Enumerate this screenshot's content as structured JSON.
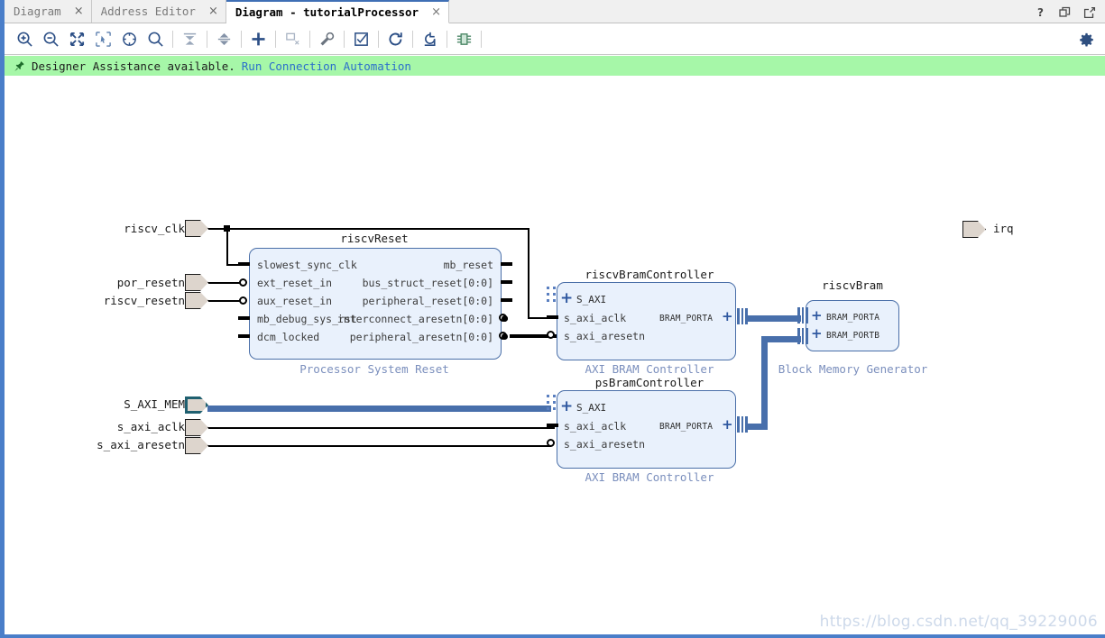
{
  "window": {
    "tabs": [
      {
        "label": "Diagram",
        "active": false,
        "close": "×"
      },
      {
        "label": "Address Editor",
        "active": false,
        "close": "×"
      },
      {
        "label": "Diagram - tutorialProcessor",
        "active": true,
        "close": "×"
      }
    ],
    "controls": [
      {
        "name": "help-icon",
        "glyph": "?"
      },
      {
        "name": "restore-icon",
        "glyph": "❐"
      },
      {
        "name": "maximize-icon",
        "glyph": "↗"
      }
    ]
  },
  "toolbar": {
    "buttons": [
      {
        "name": "zoom-in-icon",
        "tip": "Zoom In"
      },
      {
        "name": "zoom-out-icon",
        "tip": "Zoom Out"
      },
      {
        "name": "zoom-fit-icon",
        "tip": "Fit Diagram in Window"
      },
      {
        "name": "zoom-area-icon",
        "tip": "Zoom to Selected Area"
      },
      {
        "name": "refit-icon",
        "tip": "Refit"
      },
      {
        "name": "search-icon",
        "tip": "Search"
      },
      {
        "name": "collapse-all-icon",
        "tip": "Collapse All"
      },
      {
        "name": "expand-all-icon",
        "tip": "Expand All"
      },
      {
        "name": "add-ip-icon",
        "tip": "Add IP"
      },
      {
        "name": "add-module-icon",
        "tip": "Add Module"
      },
      {
        "name": "customize-block-icon",
        "tip": "Customize Block"
      },
      {
        "name": "validate-design-icon",
        "tip": "Validate Design"
      },
      {
        "name": "regenerate-layout-icon",
        "tip": "Regenerate Layout"
      },
      {
        "name": "optimize-routing-icon",
        "tip": "Optimize Routing"
      },
      {
        "name": "hierarchy-icon",
        "tip": "Create Hierarchy"
      }
    ],
    "settings": {
      "name": "gear-icon",
      "tip": "Settings"
    }
  },
  "banner": {
    "icon": "pin-icon",
    "message": "Designer Assistance available.",
    "link": "Run Connection Automation"
  },
  "canvas": {
    "external_ports": [
      {
        "id": "riscv_clk",
        "label": "riscv_clk",
        "style": "plain"
      },
      {
        "id": "por_resetn",
        "label": "por_resetn",
        "style": "plain"
      },
      {
        "id": "riscv_resetn",
        "label": "riscv_resetn",
        "style": "plain"
      },
      {
        "id": "S_AXI_MEM",
        "label": "S_AXI_MEM",
        "style": "interface"
      },
      {
        "id": "s_axi_aclk",
        "label": "s_axi_aclk",
        "style": "plain"
      },
      {
        "id": "s_axi_aresetn",
        "label": "s_axi_aresetn",
        "style": "plain"
      },
      {
        "id": "irq",
        "label": "irq",
        "style": "plain"
      }
    ],
    "blocks": [
      {
        "id": "riscvReset",
        "title": "riscvReset",
        "subtitle": "Processor System Reset",
        "inputs": [
          "slowest_sync_clk",
          "ext_reset_in",
          "aux_reset_in",
          "mb_debug_sys_rst",
          "dcm_locked"
        ],
        "outputs": [
          "mb_reset",
          "bus_struct_reset[0:0]",
          "peripheral_reset[0:0]",
          "interconnect_aresetn[0:0]",
          "peripheral_aresetn[0:0]"
        ]
      },
      {
        "id": "riscvBramController",
        "title": "riscvBramController",
        "subtitle": "AXI BRAM Controller",
        "interface_in": "S_AXI",
        "inputs": [
          "s_axi_aclk",
          "s_axi_aresetn"
        ],
        "interface_out": "BRAM_PORTA"
      },
      {
        "id": "riscvBram",
        "title": "riscvBram",
        "subtitle": "Block Memory Generator",
        "interfaces": [
          "BRAM_PORTA",
          "BRAM_PORTB"
        ]
      },
      {
        "id": "psBramController",
        "title": "psBramController",
        "subtitle": "AXI BRAM Controller",
        "interface_in": "S_AXI",
        "inputs": [
          "s_axi_aclk",
          "s_axi_aresetn"
        ],
        "interface_out": "BRAM_PORTA"
      }
    ],
    "watermark": "https://blog.csdn.net/qq_39229006"
  },
  "colors": {
    "accent": "#4a7ec9",
    "banner_bg": "#a6f7a8",
    "link": "#2b6ecb",
    "block_fill": "#e9f1fc",
    "block_border": "#4a6fa8",
    "block_subtitle": "#7b8fbd",
    "bus_wire": "#486fab",
    "port_fill": "#ddd5cd",
    "port_interface_border": "#1f6070"
  }
}
